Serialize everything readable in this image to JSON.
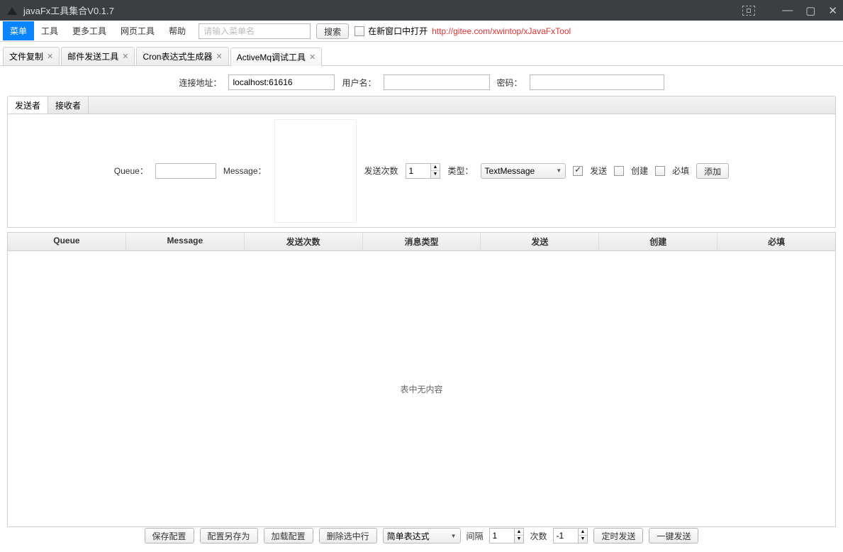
{
  "window": {
    "title": "javaFx工具集合V0.1.7"
  },
  "menu": {
    "items": [
      "菜单",
      "工具",
      "更多工具",
      "网页工具",
      "帮助"
    ],
    "search_placeholder": "请输入菜单名",
    "search_btn": "搜索",
    "newwindow_label": "在新窗口中打开",
    "link": "http://gitee.com/xwintop/xJavaFxTool"
  },
  "tabs": [
    "文件复制",
    "邮件发送工具",
    "Cron表达式生成器",
    "ActiveMq调试工具"
  ],
  "conn": {
    "addr_label": "连接地址：",
    "addr_value": "localhost:61616",
    "user_label": "用户名：",
    "user_value": "",
    "pass_label": "密码：",
    "pass_value": ""
  },
  "subtabs": [
    "发送者",
    "接收者"
  ],
  "form": {
    "queue_label": "Queue：",
    "queue_value": "",
    "message_label": "Message：",
    "sendcount_label": "发送次数",
    "sendcount_value": "1",
    "type_label": "类型：",
    "type_value": "TextMessage",
    "send_label": "发送",
    "create_label": "创建",
    "required_label": "必填",
    "add_btn": "添加"
  },
  "table": {
    "headers": [
      "Queue",
      "Message",
      "发送次数",
      "消息类型",
      "发送",
      "创建",
      "必填"
    ],
    "empty": "表中无内容"
  },
  "footer": {
    "save_config": "保存配置",
    "saveas_config": "配置另存为",
    "load_config": "加载配置",
    "delete_row": "删除选中行",
    "simple_expr": "简单表达式",
    "interval_label": "间隔",
    "interval_value": "1",
    "count_label": "次数",
    "count_value": "-1",
    "timed_send": "定时发送",
    "onekey_send": "一键发送"
  }
}
